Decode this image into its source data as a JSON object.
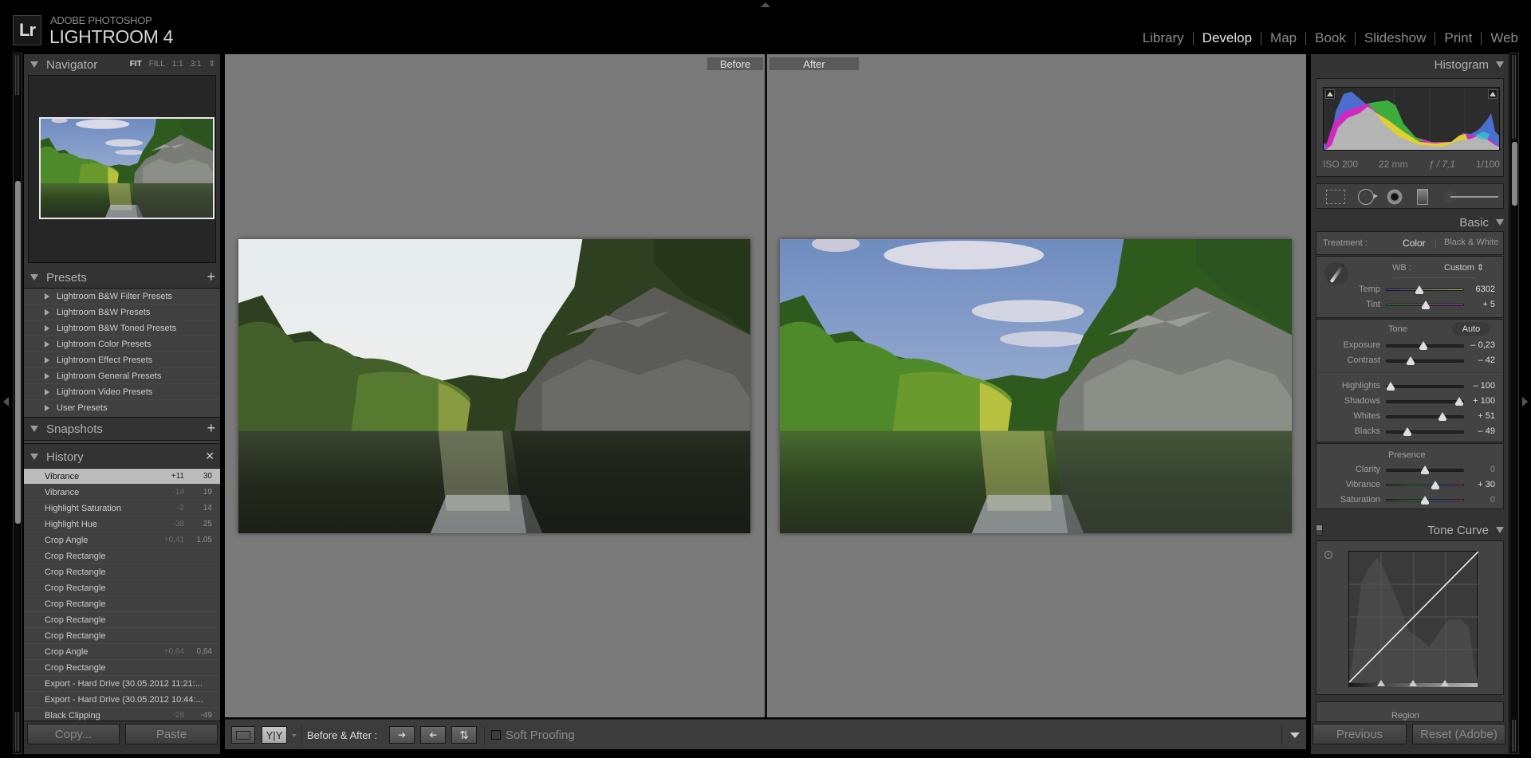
{
  "app": {
    "logo": "Lr",
    "brand_sub": "ADOBE PHOTOSHOP",
    "brand_main": "LIGHTROOM 4"
  },
  "modules": [
    {
      "label": "Library",
      "active": false
    },
    {
      "label": "Develop",
      "active": true
    },
    {
      "label": "Map",
      "active": false
    },
    {
      "label": "Book",
      "active": false
    },
    {
      "label": "Slideshow",
      "active": false
    },
    {
      "label": "Print",
      "active": false
    },
    {
      "label": "Web",
      "active": false
    }
  ],
  "left": {
    "navigator": {
      "title": "Navigator",
      "zoom_options": [
        "FIT",
        "FILL",
        "1:1",
        "3:1"
      ],
      "zoom_selected": "FIT"
    },
    "presets": {
      "title": "Presets",
      "items": [
        "Lightroom B&W Filter Presets",
        "Lightroom B&W Presets",
        "Lightroom B&W Toned Presets",
        "Lightroom Color Presets",
        "Lightroom Effect Presets",
        "Lightroom General Presets",
        "Lightroom Video Presets",
        "User Presets"
      ]
    },
    "snapshots": {
      "title": "Snapshots"
    },
    "history": {
      "title": "History",
      "items": [
        {
          "name": "Vibrance",
          "delta": "+11",
          "value": "30",
          "selected": true
        },
        {
          "name": "Vibrance",
          "delta": "-14",
          "value": "19"
        },
        {
          "name": "Highlight Saturation",
          "delta": "-2",
          "value": "14"
        },
        {
          "name": "Highlight Hue",
          "delta": "-38",
          "value": "25"
        },
        {
          "name": "Crop Angle",
          "delta": "+0,41",
          "value": "1,05"
        },
        {
          "name": "Crop Rectangle",
          "delta": "",
          "value": ""
        },
        {
          "name": "Crop Rectangle",
          "delta": "",
          "value": ""
        },
        {
          "name": "Crop Rectangle",
          "delta": "",
          "value": ""
        },
        {
          "name": "Crop Rectangle",
          "delta": "",
          "value": ""
        },
        {
          "name": "Crop Rectangle",
          "delta": "",
          "value": ""
        },
        {
          "name": "Crop Rectangle",
          "delta": "",
          "value": ""
        },
        {
          "name": "Crop Angle",
          "delta": "+0,64",
          "value": "0,64"
        },
        {
          "name": "Crop Rectangle",
          "delta": "",
          "value": ""
        },
        {
          "name": "Export - Hard Drive (30.05.2012 11:21:...",
          "delta": "",
          "value": ""
        },
        {
          "name": "Export - Hard Drive (30.05.2012 10:44:...",
          "delta": "",
          "value": ""
        },
        {
          "name": "Black Clipping",
          "delta": "-28",
          "value": "-49"
        }
      ]
    },
    "copy_label": "Copy...",
    "paste_label": "Paste"
  },
  "center": {
    "before_label": "Before",
    "after_label": "After"
  },
  "toolbar": {
    "view_yy": "Y|Y",
    "before_after_label": "Before & After :",
    "soft_proofing_label": "Soft Proofing",
    "soft_proofing_checked": false
  },
  "right": {
    "histogram": {
      "title": "Histogram",
      "iso": "ISO 200",
      "focal": "22 mm",
      "aperture": "ƒ / 7,1",
      "shutter": "1/100"
    },
    "basic": {
      "title": "Basic",
      "treatment_label": "Treatment :",
      "treatment_color": "Color",
      "treatment_bw": "Black & White",
      "wb_label": "WB :",
      "wb_value": "Custom",
      "tone_label": "Tone",
      "auto_label": "Auto",
      "presence_label": "Presence",
      "sliders": [
        {
          "name": "Temp",
          "value": "6302",
          "pos": 0.43
        },
        {
          "name": "Tint",
          "value": "+ 5",
          "pos": 0.51
        },
        {
          "name": "Exposure",
          "value": "– 0,23",
          "pos": 0.48
        },
        {
          "name": "Contrast",
          "value": "– 42",
          "pos": 0.32
        },
        {
          "name": "Highlights",
          "value": "– 100",
          "pos": 0.06
        },
        {
          "name": "Shadows",
          "value": "+ 100",
          "pos": 0.94
        },
        {
          "name": "Whites",
          "value": "+ 51",
          "pos": 0.72
        },
        {
          "name": "Blacks",
          "value": "– 49",
          "pos": 0.28
        },
        {
          "name": "Clarity",
          "value": "0",
          "pos": 0.5
        },
        {
          "name": "Vibrance",
          "value": "+ 30",
          "pos": 0.63
        },
        {
          "name": "Saturation",
          "value": "0",
          "pos": 0.5
        }
      ]
    },
    "tone_curve": {
      "title": "Tone Curve",
      "region_label": "Region"
    },
    "previous_label": "Previous",
    "reset_label": "Reset (Adobe)"
  }
}
